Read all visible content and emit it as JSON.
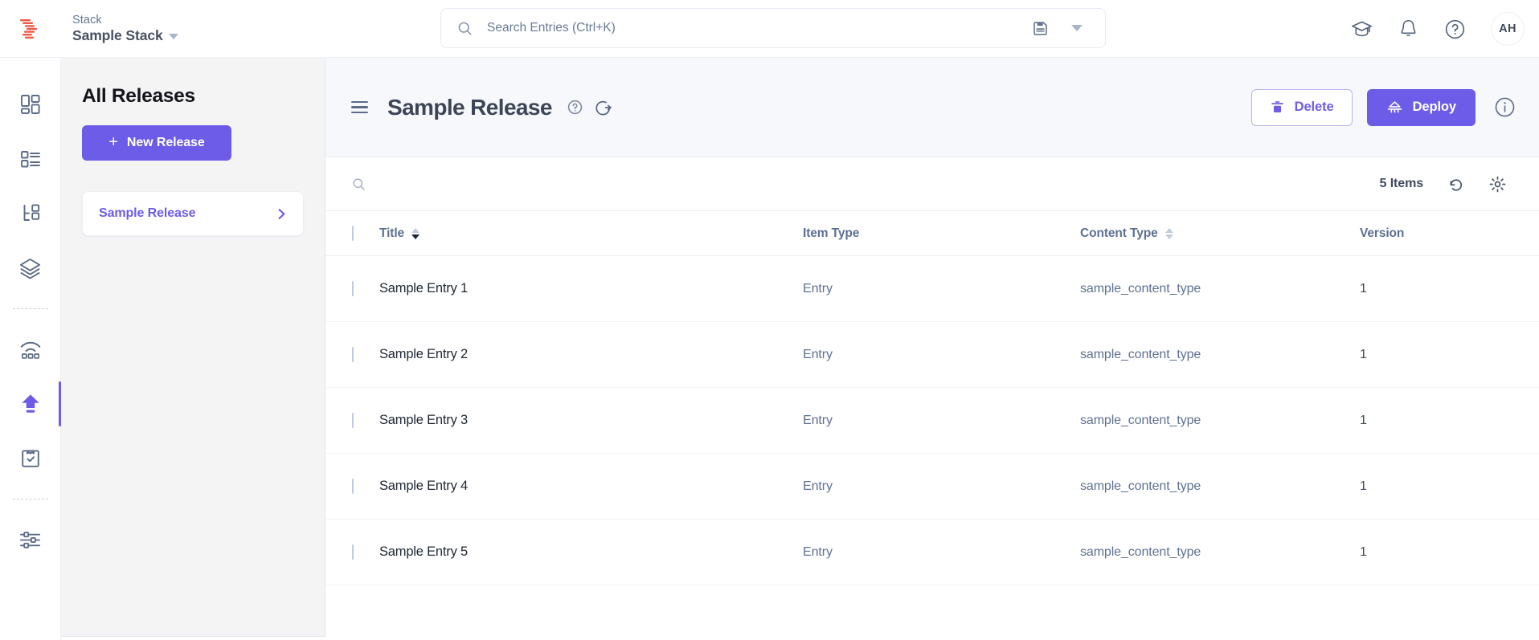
{
  "topbar": {
    "logo_name": "contentstack-logo",
    "stack_label": "Stack",
    "stack_name": "Sample Stack",
    "search": {
      "placeholder": "Search Entries (Ctrl+K)",
      "value": "",
      "search_icon": "search-icon",
      "save_icon": "save-floppy-icon",
      "dropdown_icon": "chevron-down-icon"
    },
    "icons": [
      {
        "name": "academy-graduation-cap-icon"
      },
      {
        "name": "notifications-bell-icon"
      },
      {
        "name": "help-circle-icon"
      }
    ],
    "avatar_initials": "AH"
  },
  "rail": {
    "items": [
      {
        "name": "dashboard-icon",
        "active": false
      },
      {
        "name": "content-types-icon",
        "active": false
      },
      {
        "name": "taxonomy-tree-icon",
        "active": false
      },
      {
        "name": "assets-layers-icon",
        "active": false
      },
      {
        "name": "divider-1",
        "divider": true
      },
      {
        "name": "live-preview-icon",
        "active": false
      },
      {
        "name": "releases-upload-icon",
        "active": true
      },
      {
        "name": "audit-clipboard-icon",
        "active": false
      },
      {
        "name": "divider-2",
        "divider": true
      },
      {
        "name": "settings-sliders-icon",
        "active": false
      }
    ]
  },
  "releases_panel": {
    "heading": "All Releases",
    "new_release_label": "New Release",
    "new_release_plus": "+",
    "list": [
      {
        "name": "Sample Release",
        "chevron": "chevron-right-icon",
        "selected": true
      }
    ]
  },
  "main": {
    "menu_icon": "hamburger-menu-icon",
    "title": "Sample Release",
    "title_help_icon": "help-circle-icon",
    "title_action_icon": "rotate-deploy-icon",
    "delete_label": "Delete",
    "delete_icon": "trash-icon",
    "deploy_label": "Deploy",
    "deploy_icon": "deploy-icon",
    "info_icon": "info-circle-icon"
  },
  "toolbar": {
    "search_icon": "search-icon",
    "items_count": "5 Items",
    "refresh_icon": "undo-refresh-icon",
    "settings_icon": "gear-icon"
  },
  "table": {
    "columns": [
      {
        "key": "title",
        "label": "Title",
        "sortable": true,
        "sort": "desc"
      },
      {
        "key": "item_type",
        "label": "Item Type",
        "sortable": false,
        "sort": "none"
      },
      {
        "key": "content_type",
        "label": "Content Type",
        "sortable": true,
        "sort": "none"
      },
      {
        "key": "version",
        "label": "Version",
        "sortable": false,
        "sort": "none"
      }
    ],
    "rows": [
      {
        "title": "Sample Entry 1",
        "item_type": "Entry",
        "content_type": "sample_content_type",
        "version": "1"
      },
      {
        "title": "Sample Entry 2",
        "item_type": "Entry",
        "content_type": "sample_content_type",
        "version": "1"
      },
      {
        "title": "Sample Entry 3",
        "item_type": "Entry",
        "content_type": "sample_content_type",
        "version": "1"
      },
      {
        "title": "Sample Entry 4",
        "item_type": "Entry",
        "content_type": "sample_content_type",
        "version": "1"
      },
      {
        "title": "Sample Entry 5",
        "item_type": "Entry",
        "content_type": "sample_content_type",
        "version": "1"
      }
    ]
  },
  "colors": {
    "accent": "#6c5ce7",
    "panel_bg": "#f4f4f5",
    "header_bg": "#f7f8fc",
    "text_dark": "#1f2633",
    "text_muted": "#5e7092",
    "logo_red": "#ec5b45"
  }
}
